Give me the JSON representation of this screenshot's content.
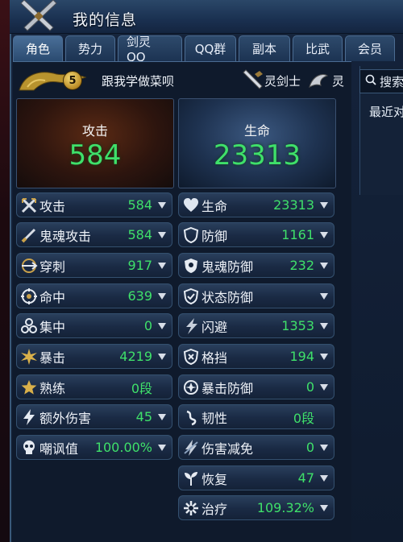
{
  "window": {
    "title": "我的信息"
  },
  "tabs": [
    {
      "label": "角色",
      "active": true
    },
    {
      "label": "势力",
      "active": false
    },
    {
      "label": "剑灵 QQ",
      "active": false
    },
    {
      "label": "QQ群",
      "active": false
    },
    {
      "label": "副本",
      "active": false
    },
    {
      "label": "比武",
      "active": false
    },
    {
      "label": "会员",
      "active": false
    }
  ],
  "character": {
    "level": "5",
    "name": "跟我学做菜呗",
    "class_name": "灵剑士",
    "race_name": "灵"
  },
  "side": {
    "search_label": "搜索",
    "recent_label": "最近对"
  },
  "summary": {
    "attack": {
      "label": "攻击",
      "value": "584"
    },
    "life": {
      "label": "生命",
      "value": "23313"
    }
  },
  "stats_left": [
    {
      "icon": "crossed-swords-icon",
      "label": "攻击",
      "value": "584"
    },
    {
      "icon": "ghost-sword-icon",
      "label": "鬼魂攻击",
      "value": "584"
    },
    {
      "icon": "pierce-icon",
      "label": "穿刺",
      "value": "917"
    },
    {
      "icon": "target-icon",
      "label": "命中",
      "value": "639"
    },
    {
      "icon": "focus-icon",
      "label": "集中",
      "value": "0"
    },
    {
      "icon": "burst-icon",
      "label": "暴击",
      "value": "4219"
    },
    {
      "icon": "star-icon",
      "label": "熟练",
      "value": "0段"
    },
    {
      "icon": "lightning-icon",
      "label": "额外伤害",
      "value": "45"
    },
    {
      "icon": "skull-icon",
      "label": "嘲讽值",
      "value": "100.00%"
    }
  ],
  "stats_right": [
    {
      "icon": "heart-icon",
      "label": "生命",
      "value": "23313"
    },
    {
      "icon": "shield-icon",
      "label": "防御",
      "value": "1161"
    },
    {
      "icon": "ghost-shield-icon",
      "label": "鬼魂防御",
      "value": "232"
    },
    {
      "icon": "status-shield-icon",
      "label": "状态防御",
      "value": ""
    },
    {
      "icon": "dodge-icon",
      "label": "闪避",
      "value": "1353"
    },
    {
      "icon": "block-icon",
      "label": "格挡",
      "value": "194"
    },
    {
      "icon": "crit-defense-icon",
      "label": "暴击防御",
      "value": "0"
    },
    {
      "icon": "tenacity-icon",
      "label": "韧性",
      "value": "0段"
    },
    {
      "icon": "damage-reduction-icon",
      "label": "伤害减免",
      "value": "0"
    },
    {
      "icon": "recovery-icon",
      "label": "恢复",
      "value": "47"
    },
    {
      "icon": "healing-icon",
      "label": "治疗",
      "value": "109.32%"
    }
  ],
  "colors": {
    "value_green": "#3fe06a",
    "tab_active": "#4a6f98",
    "panel_bg": "#0f1a2c"
  }
}
